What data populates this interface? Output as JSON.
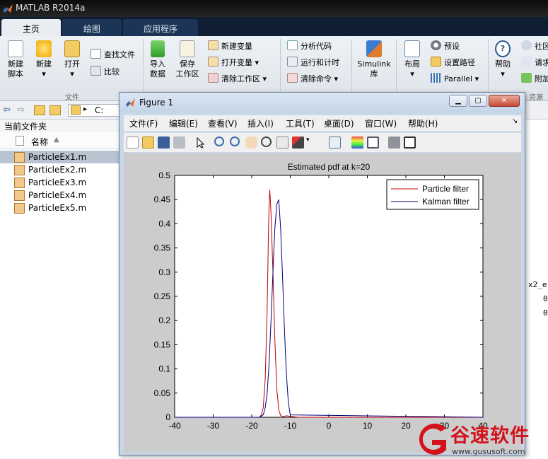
{
  "app": {
    "title": "MATLAB R2014a"
  },
  "tabs": [
    {
      "label": "主页",
      "active": true
    },
    {
      "label": "绘图",
      "active": false
    },
    {
      "label": "应用程序",
      "active": false
    }
  ],
  "ribbon": {
    "file_group": {
      "new_script": "新建\n脚本",
      "new": "新建",
      "open": "打开",
      "find_files": "查找文件",
      "compare": "比较",
      "label": "文件"
    },
    "variable_group": {
      "import_data": "导入\n数据",
      "save_workspace": "保存\n工作区",
      "new_variable": "新建变量",
      "open_variable": "打开变量",
      "clear_workspace": "清除工作区"
    },
    "code_group": {
      "analyze_code": "分析代码",
      "run_and_time": "运行和计时",
      "clear_commands": "清除命令"
    },
    "simulink": {
      "label": "Simulink\n库"
    },
    "environment": {
      "layout": "布局",
      "preferences": "预设",
      "set_path": "设置路径",
      "parallel": "Parallel"
    },
    "resources": {
      "help": "帮助",
      "community": "社区",
      "request": "请求",
      "addons": "附加",
      "label": "资源"
    }
  },
  "address": {
    "path": "C:"
  },
  "current_folder": {
    "title": "当前文件夹",
    "column_name": "名称",
    "files": [
      "ParticleEx1.m",
      "ParticleEx2.m",
      "ParticleEx3.m",
      "ParticleEx4.m",
      "ParticleEx5.m"
    ],
    "selected_index": 0
  },
  "workspace_peek": {
    "var": "x2_e",
    "v1": "0",
    "v2": "0"
  },
  "figure": {
    "title": "Figure 1",
    "menu": [
      "文件(F)",
      "编辑(E)",
      "查看(V)",
      "插入(I)",
      "工具(T)",
      "桌面(D)",
      "窗口(W)",
      "帮助(H)"
    ],
    "dock_glyph": "↘"
  },
  "chart_data": {
    "type": "line",
    "title": "Estimated pdf at k=20",
    "xlabel": "",
    "ylabel": "",
    "xlim": [
      -40,
      40
    ],
    "ylim": [
      0,
      0.5
    ],
    "xticks": [
      -40,
      -30,
      -20,
      -10,
      0,
      10,
      20,
      30,
      40
    ],
    "yticks": [
      0,
      0.05,
      0.1,
      0.15,
      0.2,
      0.25,
      0.3,
      0.35,
      0.4,
      0.45,
      0.5
    ],
    "legend_position": "top-right",
    "series": [
      {
        "name": "Particle filter",
        "color": "#c00000",
        "x": [
          -40,
          -18,
          -17.5,
          -17,
          -16.5,
          -16,
          -15.7,
          -15.5,
          -15.3,
          -15,
          -14.5,
          -14,
          -13.5,
          -13,
          -12.5,
          -12,
          -11,
          -10,
          -8,
          40
        ],
        "y": [
          0,
          0,
          0.005,
          0.02,
          0.08,
          0.22,
          0.36,
          0.44,
          0.47,
          0.42,
          0.3,
          0.16,
          0.06,
          0.015,
          0.004,
          0.001,
          0.003,
          0.002,
          0,
          0
        ]
      },
      {
        "name": "Kalman filter",
        "color": "#00007f",
        "x": [
          -40,
          -18,
          -17,
          -16.5,
          -16,
          -15.5,
          -15,
          -14.5,
          -14,
          -13.5,
          -13,
          -12.5,
          -12,
          -11.5,
          -11,
          -10.5,
          -10,
          40
        ],
        "y": [
          0,
          0,
          0.005,
          0.02,
          0.05,
          0.11,
          0.2,
          0.3,
          0.39,
          0.44,
          0.45,
          0.39,
          0.29,
          0.18,
          0.09,
          0.03,
          0.005,
          0
        ]
      }
    ]
  },
  "colors": {
    "titlebar": "#1a1a1a",
    "tab_active": "#e9edf2",
    "figure_frame": "#c8d7ea",
    "plot_bg": "#ffffff",
    "figure_bg": "#cccccc",
    "watermark_red": "#d3121b"
  },
  "watermark": {
    "brand": "谷速软件",
    "url": "www.gususoft.com"
  }
}
